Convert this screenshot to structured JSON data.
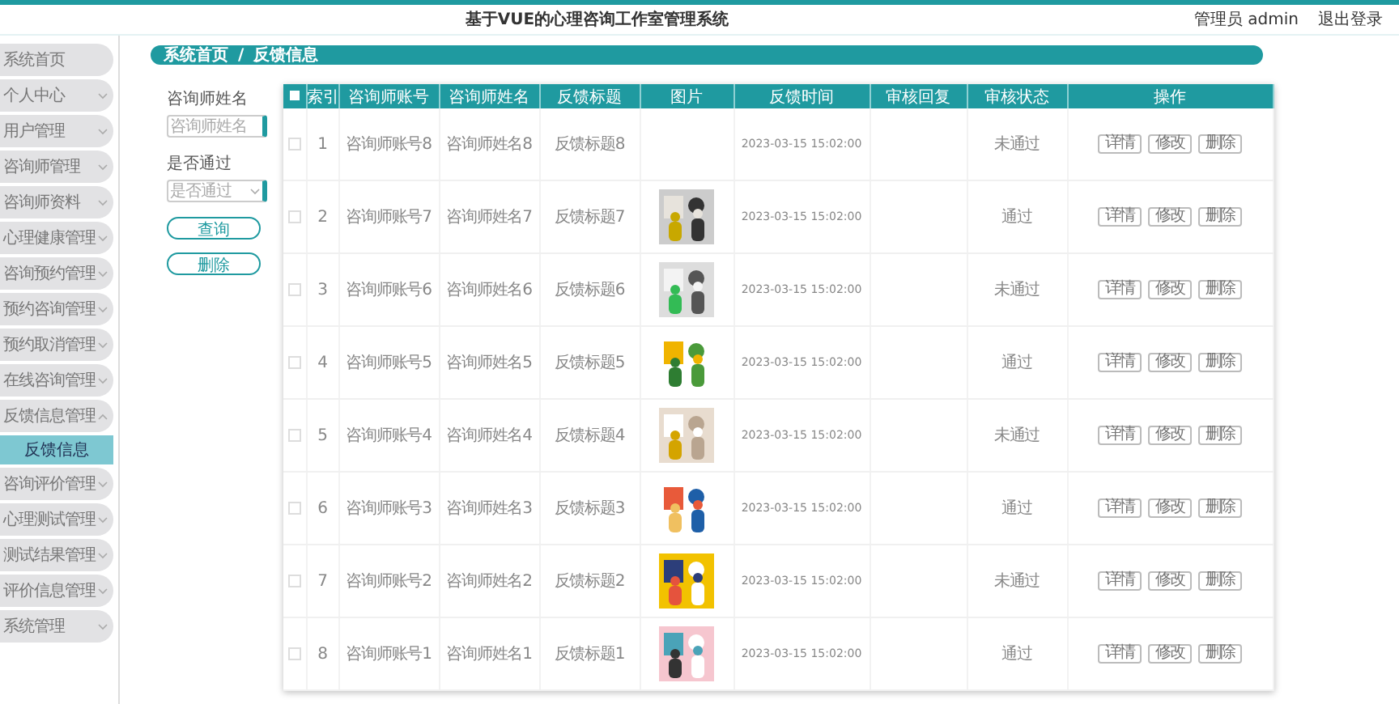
{
  "header": {
    "title": "基于VUE的心理咨询工作室管理系统",
    "user": "管理员 admin",
    "logout": "退出登录"
  },
  "sidebar": {
    "items": [
      {
        "label": "系统首页",
        "kind": "link"
      },
      {
        "label": "个人中心",
        "kind": "group",
        "expanded": false
      },
      {
        "label": "用户管理",
        "kind": "group",
        "expanded": false
      },
      {
        "label": "咨询师管理",
        "kind": "group",
        "expanded": false
      },
      {
        "label": "咨询师资料",
        "kind": "group",
        "expanded": false
      },
      {
        "label": "心理健康管理",
        "kind": "group",
        "expanded": false
      },
      {
        "label": "咨询预约管理",
        "kind": "group",
        "expanded": false
      },
      {
        "label": "预约咨询管理",
        "kind": "group",
        "expanded": false
      },
      {
        "label": "预约取消管理",
        "kind": "group",
        "expanded": false
      },
      {
        "label": "在线咨询管理",
        "kind": "group",
        "expanded": false
      },
      {
        "label": "反馈信息管理",
        "kind": "group",
        "expanded": true,
        "children": [
          {
            "label": "反馈信息",
            "selected": true
          }
        ]
      },
      {
        "label": "咨询评价管理",
        "kind": "group",
        "expanded": false
      },
      {
        "label": "心理测试管理",
        "kind": "group",
        "expanded": false
      },
      {
        "label": "测试结果管理",
        "kind": "group",
        "expanded": false
      },
      {
        "label": "评价信息管理",
        "kind": "group",
        "expanded": false
      },
      {
        "label": "系统管理",
        "kind": "group",
        "expanded": false
      }
    ]
  },
  "breadcrumb": [
    "系统首页",
    "反馈信息"
  ],
  "breadcrumb_separator": "/",
  "search": {
    "fields": [
      {
        "kind": "text",
        "label": "咨询师姓名",
        "placeholder": "咨询师姓名"
      },
      {
        "kind": "select",
        "label": "是否通过",
        "placeholder": "是否通过"
      }
    ],
    "buttons": [
      "查询",
      "删除"
    ]
  },
  "table": {
    "all_selected": false,
    "columns": [
      "索引",
      "咨询师账号",
      "咨询师姓名",
      "反馈标题",
      "图片",
      "反馈时间",
      "审核回复",
      "审核状态",
      "操作"
    ],
    "rows": [
      {
        "index": "1",
        "account": "咨询师账号8",
        "name": "咨询师姓名8",
        "title": "反馈标题8",
        "has_picture": false,
        "time": "2023-03-15 15:02:00",
        "status": "未通过",
        "selected": false,
        "actions": [
          "详情",
          "修改",
          "删除"
        ]
      },
      {
        "index": "2",
        "account": "咨询师账号7",
        "name": "咨询师姓名7",
        "title": "反馈标题7",
        "has_picture": true,
        "time": "2023-03-15 15:02:00",
        "status": "通过",
        "selected": false,
        "actions": [
          "详情",
          "修改",
          "删除"
        ]
      },
      {
        "index": "3",
        "account": "咨询师账号6",
        "name": "咨询师姓名6",
        "title": "反馈标题6",
        "has_picture": true,
        "time": "2023-03-15 15:02:00",
        "status": "未通过",
        "selected": false,
        "actions": [
          "详情",
          "修改",
          "删除"
        ]
      },
      {
        "index": "4",
        "account": "咨询师账号5",
        "name": "咨询师姓名5",
        "title": "反馈标题5",
        "has_picture": true,
        "time": "2023-03-15 15:02:00",
        "status": "通过",
        "selected": false,
        "actions": [
          "详情",
          "修改",
          "删除"
        ]
      },
      {
        "index": "5",
        "account": "咨询师账号4",
        "name": "咨询师姓名4",
        "title": "反馈标题4",
        "has_picture": true,
        "time": "2023-03-15 15:02:00",
        "status": "未通过",
        "selected": false,
        "actions": [
          "详情",
          "修改",
          "删除"
        ]
      },
      {
        "index": "6",
        "account": "咨询师账号3",
        "name": "咨询师姓名3",
        "title": "反馈标题3",
        "has_picture": true,
        "time": "2023-03-15 15:02:00",
        "status": "通过",
        "selected": false,
        "actions": [
          "详情",
          "修改",
          "删除"
        ]
      },
      {
        "index": "7",
        "account": "咨询师账号2",
        "name": "咨询师姓名2",
        "title": "反馈标题2",
        "has_picture": true,
        "time": "2023-03-15 15:02:00",
        "status": "未通过",
        "selected": false,
        "actions": [
          "详情",
          "修改",
          "删除"
        ]
      },
      {
        "index": "8",
        "account": "咨询师账号1",
        "name": "咨询师姓名1",
        "title": "反馈标题1",
        "has_picture": true,
        "time": "2023-03-15 15:02:00",
        "status": "通过",
        "selected": false,
        "actions": [
          "详情",
          "修改",
          "删除"
        ]
      }
    ]
  }
}
